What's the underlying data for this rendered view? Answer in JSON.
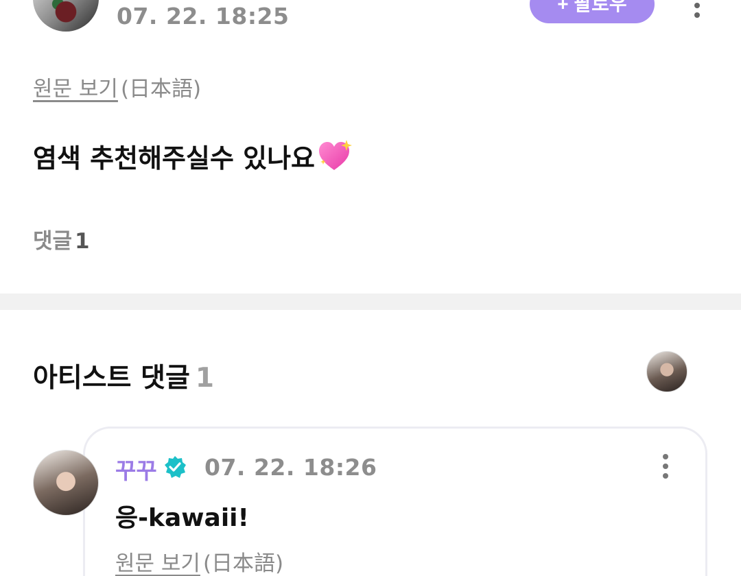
{
  "post": {
    "date": "07. 22. 18:25",
    "follow_label": "+ 팔로우",
    "view_original": "원문 보기",
    "original_language": "(日本語)",
    "body": "염색 추천해주실수 있나요",
    "body_emoji": "sparkling-heart-icon",
    "comment_label": "댓글",
    "comment_count": "1"
  },
  "artist_comments": {
    "title": "아티스트 댓글",
    "count": "1",
    "comment": {
      "author": "꾸꾸",
      "verified_icon": "verified-badge-icon",
      "date": "07. 22. 18:26",
      "body": "응-kawaii!",
      "view_original": "원문 보기",
      "original_language": "(日本語)"
    }
  },
  "colors": {
    "accent": "#a58bf0",
    "author_name": "#9b7be6",
    "verified": "#1cc0c8",
    "muted_text": "#8d8d8d",
    "divider": "#f1f1f1"
  }
}
